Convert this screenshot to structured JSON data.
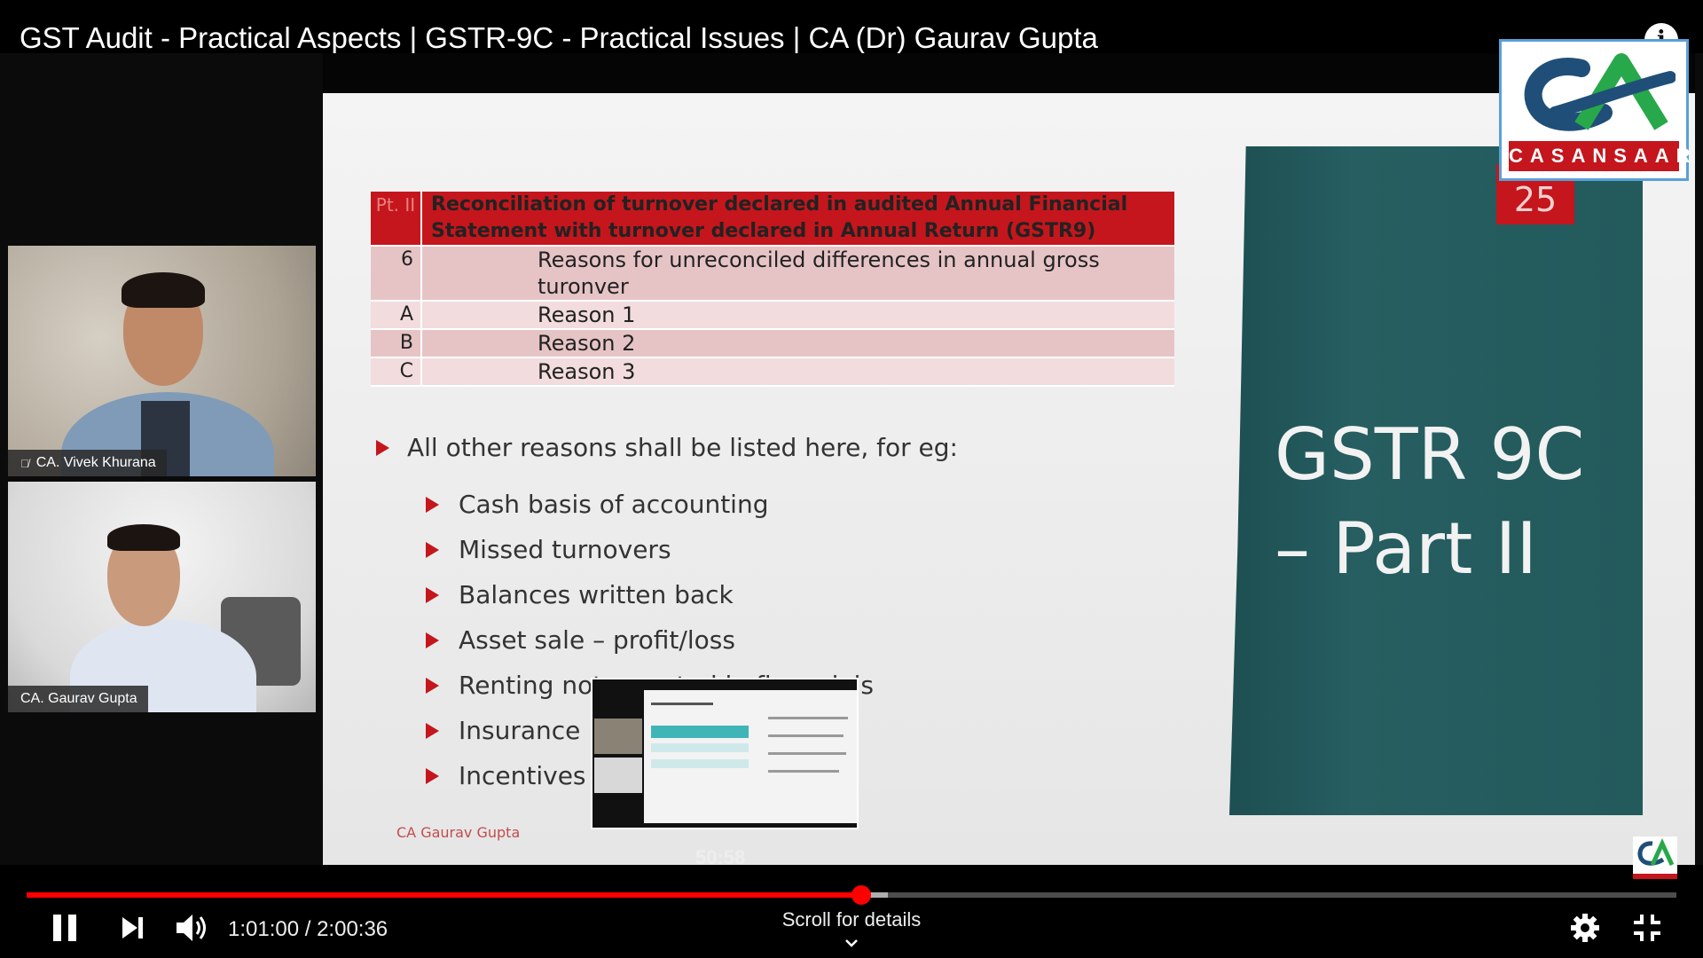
{
  "video": {
    "title": "GST Audit - Practical Aspects | GSTR-9C - Practical Issues | CA (Dr) Gaurav Gupta"
  },
  "participants": [
    {
      "name": "CA. Vivek Khurana",
      "muted": true
    },
    {
      "name": "CA. Gaurav Gupta",
      "muted": false
    }
  ],
  "slide": {
    "number": "25",
    "table": {
      "header": {
        "part": "Pt. II",
        "text": "Reconciliation of turnover declared in audited Annual Financial Statement with turnover declared in Annual Return (GSTR9)"
      },
      "rows": [
        {
          "no": "6",
          "text": "Reasons for unreconciled differences in annual gross turonver"
        },
        {
          "no": "A",
          "text": "Reason 1"
        },
        {
          "no": "B",
          "text": "Reason 2"
        },
        {
          "no": "C",
          "text": "Reason 3"
        }
      ]
    },
    "main_bullet": "All other reasons shall be listed here, for eg:",
    "sub_bullets": [
      "Cash basis of accounting",
      "Missed turnovers",
      "Balances written back",
      "Asset sale – profit/loss",
      "Renting not reported in financials",
      "Insurance",
      "Incentives"
    ],
    "author": "CA Gaurav Gupta",
    "panel_title_line1": "GSTR 9C",
    "panel_title_line2": "– Part II"
  },
  "logo": {
    "text": "CASANSAAR",
    "primary_color": "#1f4f78",
    "accent_color": "#27a84a",
    "band_color": "#c4161c"
  },
  "preview": {
    "time": "50:58"
  },
  "player": {
    "current_time": "1:01:00",
    "duration": "2:00:36",
    "time_display": "1:01:00 / 2:00:36",
    "played_fraction": 0.506,
    "buffered_fraction": 0.522,
    "scroll_hint": "Scroll for details",
    "accent_color": "#ff0000",
    "icons": [
      "pause-icon",
      "next-icon",
      "volume-icon",
      "settings-icon",
      "exit-fullscreen-icon",
      "info-icon",
      "chevron-down-icon"
    ]
  }
}
